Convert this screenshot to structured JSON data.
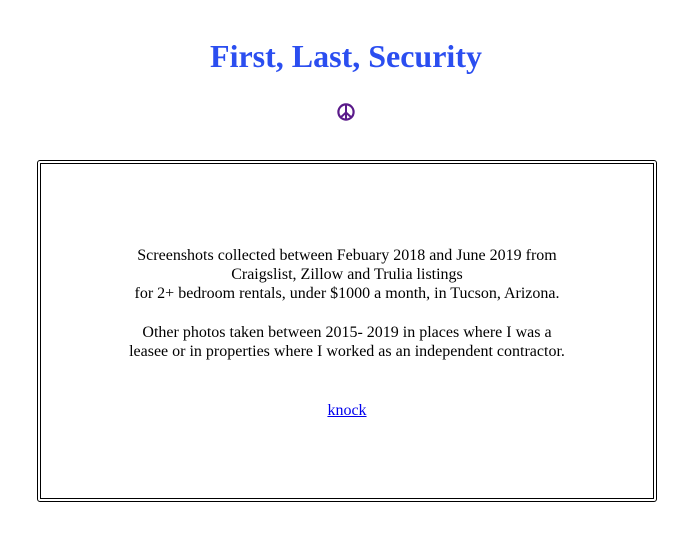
{
  "page": {
    "title": "First, Last, Security",
    "title_color": "#2b4ef0",
    "peace_icon": "peace-symbol-icon",
    "peace_icon_color": "#5a1a8a",
    "link_color": "#0000ee"
  },
  "content": {
    "paragraph1": [
      "Screenshots collected between Febuary 2018 and June 2019 from",
      "Craigslist, Zillow and Trulia listings",
      "for 2+ bedroom rentals, under $1000 a month, in Tucson, Arizona."
    ],
    "paragraph2": [
      "Other photos taken between 2015- 2019 in places where I was a",
      "leasee or in properties where I worked as an independent contractor."
    ],
    "link_text": "knock"
  }
}
